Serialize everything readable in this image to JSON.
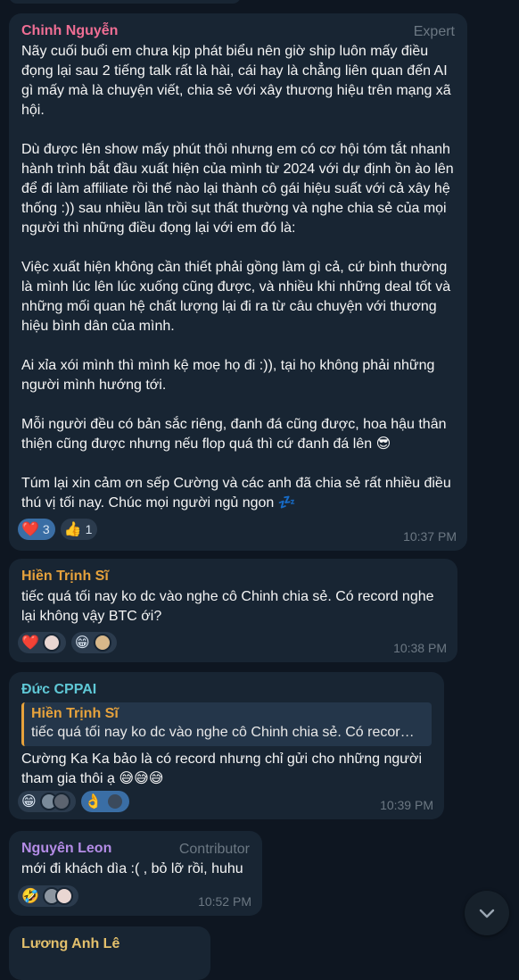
{
  "colors": {
    "background": "#0e1621",
    "bubble": "#182533",
    "name_pink": "#ef6e94",
    "name_orange": "#e6a23c",
    "name_teal": "#5fc8d6",
    "name_purple": "#b48ce6",
    "name_yellow": "#e3c06c",
    "meta_gray": "#6c7883"
  },
  "messages": [
    {
      "sender": "Chinh Nguyễn",
      "role": "Expert",
      "paragraphs": [
        "Nãy cuối buổi em chưa kịp phát biểu nên giờ ship luôn mấy điều đọng lại sau 2 tiếng talk rất là hài, cái hay là chẳng liên quan đến AI gì mấy mà là chuyện viết, chia sẻ với xây thương hiệu trên mạng xã hội.",
        "Dù được lên show mấy phút thôi nhưng em có cơ hội tóm tắt nhanh hành trình bắt đầu xuất hiện của mình từ 2024 với dự định ồn ào lên để đi làm affiliate rồi thế nào lại thành cô gái hiệu suất với cả xây hệ thống :)) sau nhiều lần trồi sụt thất thường và nghe chia sẻ của mọi người thì những điều đọng lại với em đó là:",
        "Việc xuất hiện không cần thiết phải gồng làm gì cả, cứ bình thường là mình lúc lên lúc xuống cũng được, và nhiều khi những deal tốt và những mối quan hệ chất lượng lại đi ra từ câu chuyện với thương hiệu bình dân của mình.",
        "Ai xỉa xói mình thì mình kệ moẹ họ đi :)), tại họ không phải những người mình hướng tới.",
        "Mỗi người đều có bản sắc riêng, đanh đá cũng được, hoa hậu thân thiện cũng được nhưng nếu flop quá thì cứ đanh đá lên 😎",
        "Túm lại xin cảm ơn sếp Cường và các anh đã chia sẻ rất nhiều điều thú vị tối nay. Chúc mọi người ngủ ngon 💤"
      ],
      "reactions": [
        {
          "emoji": "❤️",
          "count": "3",
          "active": true
        },
        {
          "emoji": "👍",
          "count": "1",
          "active": false
        }
      ],
      "time": "10:37 PM"
    },
    {
      "sender": "Hiền Trịnh Sĩ",
      "text": "tiếc quá tối nay ko dc vào nghe cô Chinh chia sẻ. Có record nghe lại không vậy BTC ới?",
      "reactions": [
        {
          "emoji": "❤️"
        },
        {
          "emoji": "😁"
        }
      ],
      "time": "10:38 PM"
    },
    {
      "sender": "Đức CPPAI",
      "quote": {
        "name": "Hiền Trịnh Sĩ",
        "text": "tiếc quá tối nay ko dc vào nghe cô Chinh chia sẻ. Có recor…"
      },
      "text": "Cường Ka Ka  bảo là có record nhưng chỉ gửi cho những người tham gia thôi ạ 😅😅😅",
      "reactions": [
        {
          "emoji": "😁"
        },
        {
          "emoji": "👌"
        }
      ],
      "time": "10:39 PM"
    },
    {
      "sender": "Nguyên Leon",
      "role": "Contributor",
      "text": "mới đi khách dìa :( , bỏ lỡ rồi, huhu",
      "reactions": [
        {
          "emoji": "🤣"
        }
      ],
      "time": "10:52 PM"
    },
    {
      "sender": "Lương Anh Lê"
    }
  ],
  "scroll_button": {
    "icon": "chevron-down-icon"
  }
}
